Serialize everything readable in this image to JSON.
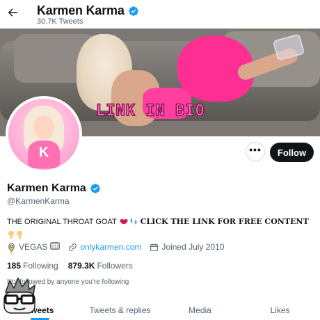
{
  "header": {
    "back_icon": "arrow-left-icon",
    "name": "Karmen Karma",
    "tweet_count": "30.7K Tweets"
  },
  "banner": {
    "overlay_text": "LINK IN BIO"
  },
  "actions": {
    "more_label": "•••",
    "follow_label": "Follow"
  },
  "profile": {
    "name": "Karmen Karma",
    "handle": "@KarmenKarma",
    "verified_icon": "verified-badge-icon",
    "bio_text": "THE ORIGINAL THROAT GOAT",
    "bio_cta": "CLICK THE LINK FOR FREE CONTENT",
    "location": "VEGAS",
    "website": "onlykarmen.com",
    "joined": "Joined July 2010",
    "following_count": "185",
    "following_label": "Following",
    "followers_count": "879.3K",
    "followers_label": "Followers",
    "not_followed": "Not followed by anyone you're following"
  },
  "tabs": [
    {
      "label": "Tweets",
      "active": true
    },
    {
      "label": "Tweets & replies",
      "active": false
    },
    {
      "label": "Media",
      "active": false
    },
    {
      "label": "Likes",
      "active": false
    }
  ],
  "colors": {
    "accent": "#1d9bf0",
    "text": "#0f1419",
    "muted": "#536471",
    "follow_bg": "#0f1419"
  }
}
